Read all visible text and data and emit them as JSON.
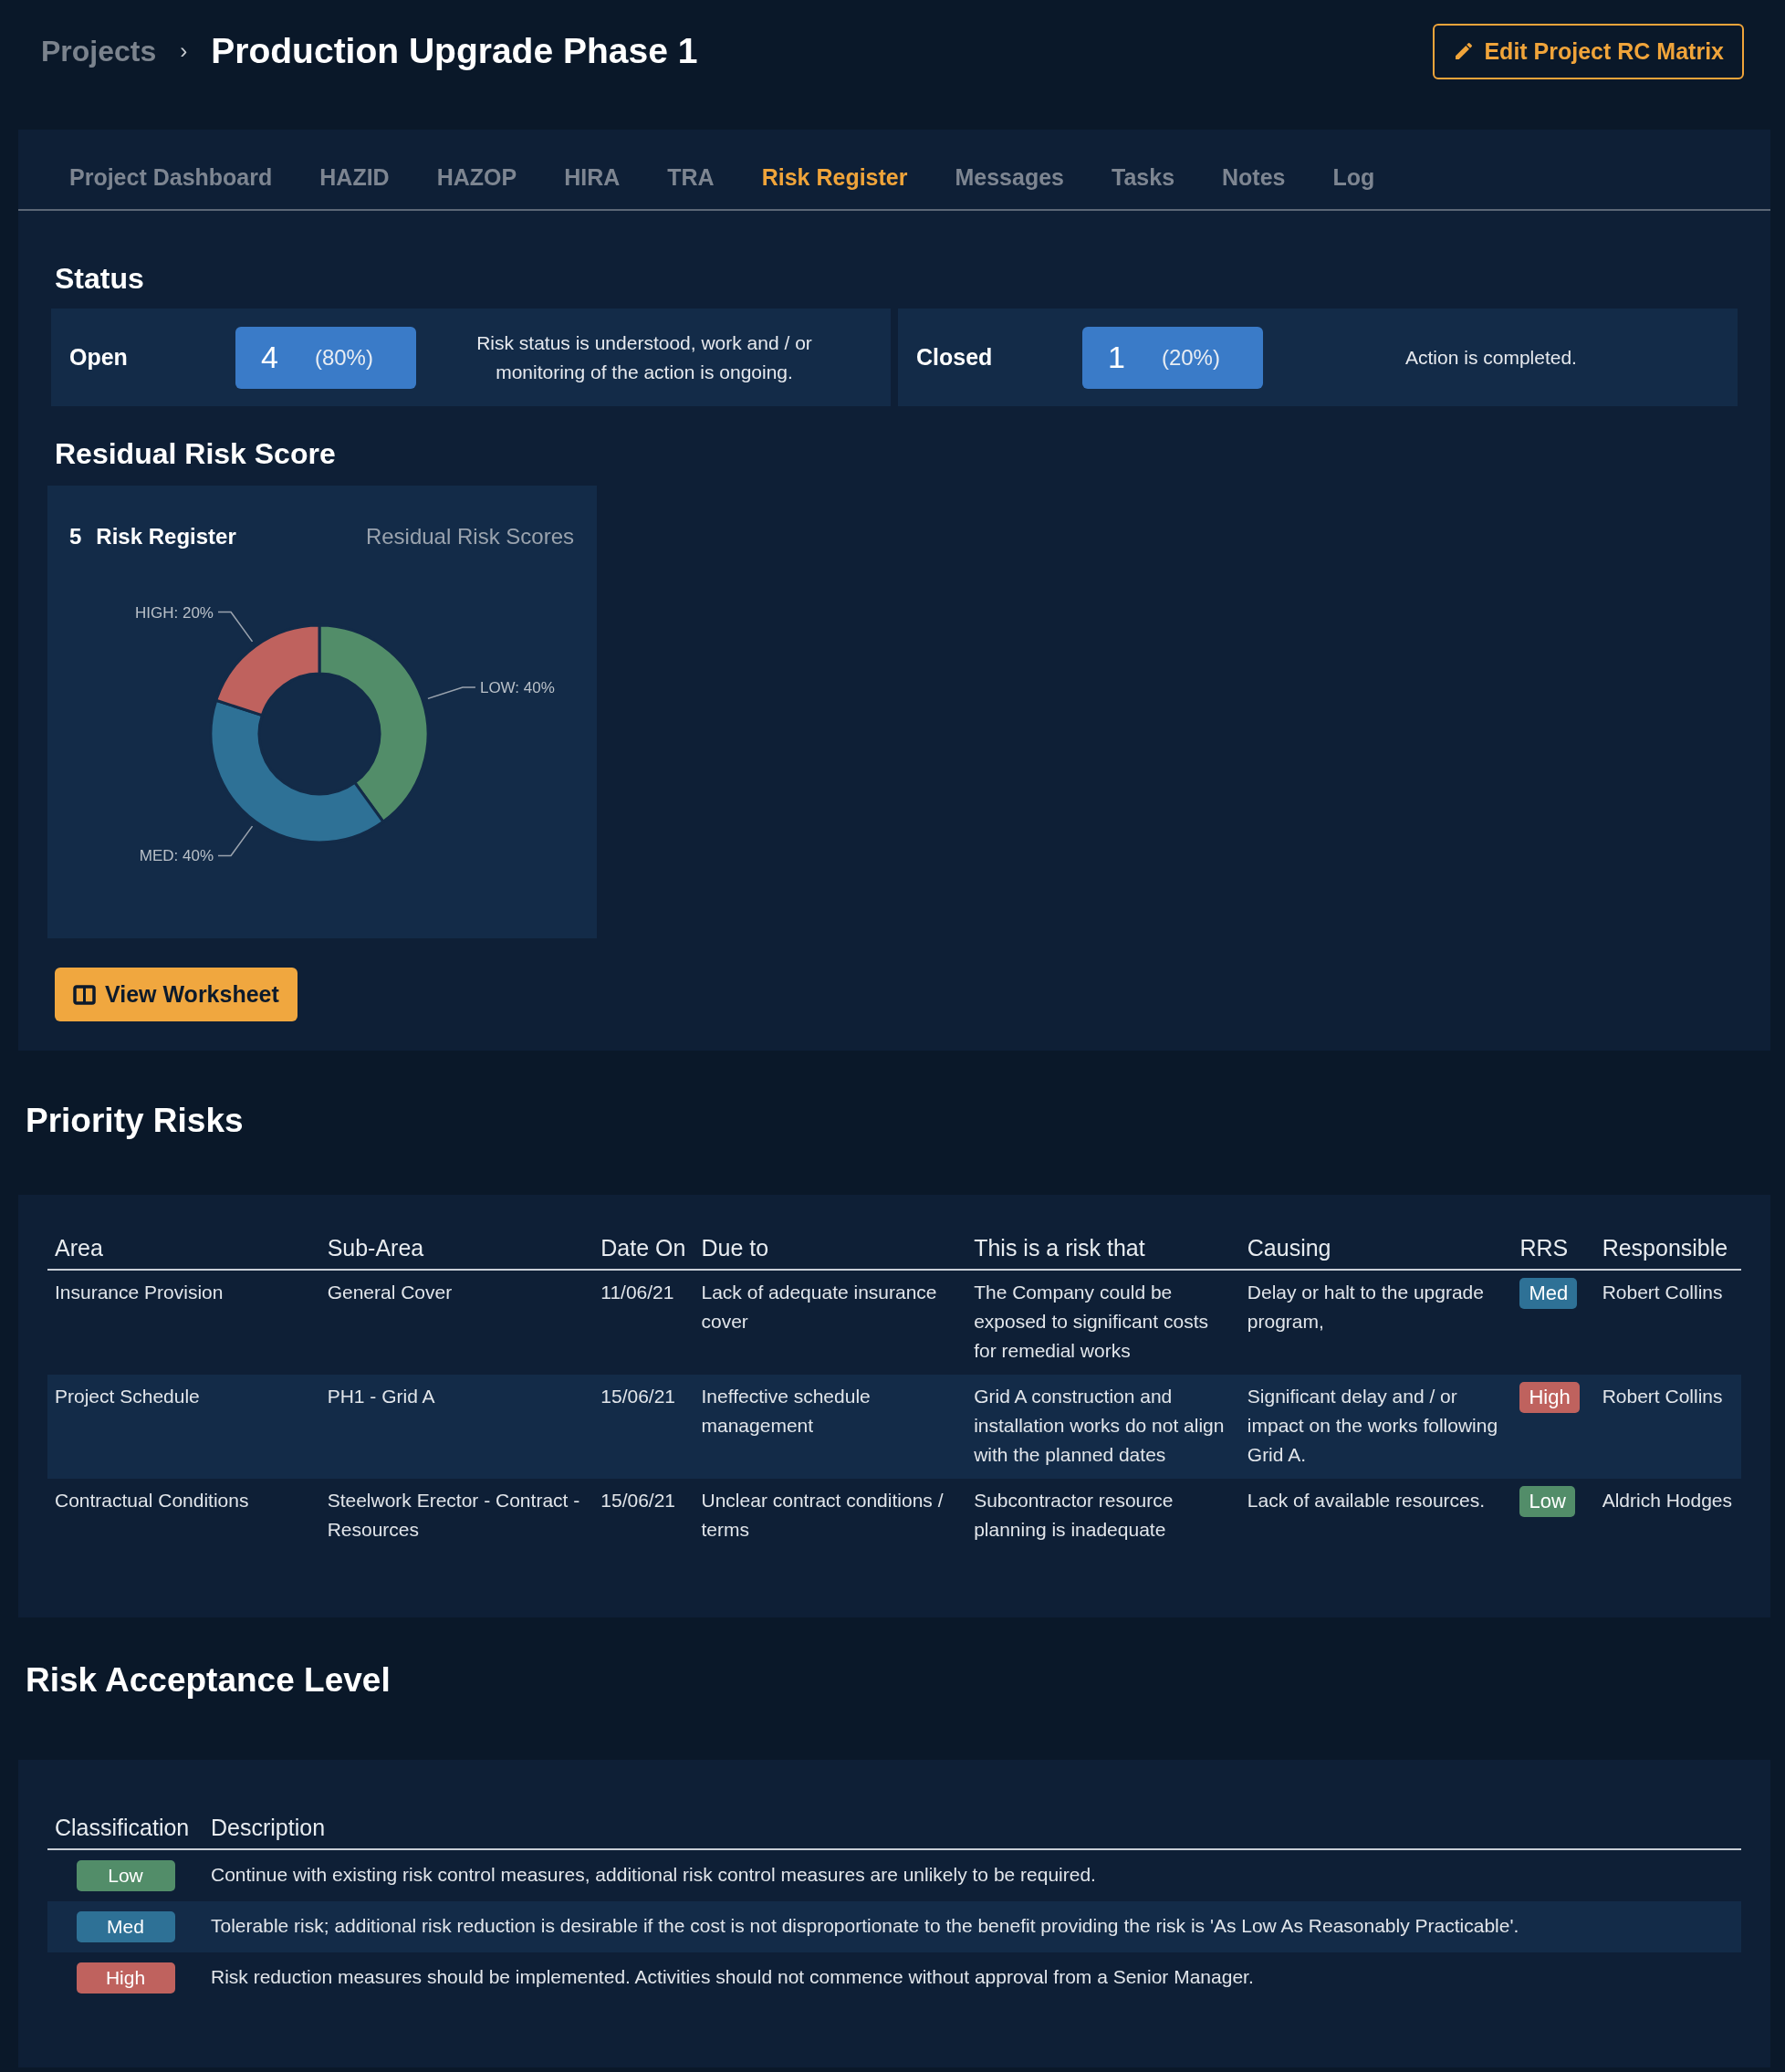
{
  "breadcrumb": {
    "parent": "Projects",
    "separator": "›",
    "title": "Production Upgrade Phase 1"
  },
  "edit_button": {
    "label": "Edit Project RC Matrix"
  },
  "tabs": [
    {
      "label": "Project Dashboard",
      "selected": false
    },
    {
      "label": "HAZID",
      "selected": false
    },
    {
      "label": "HAZOP",
      "selected": false
    },
    {
      "label": "HIRA",
      "selected": false
    },
    {
      "label": "TRA",
      "selected": false
    },
    {
      "label": "Risk Register",
      "selected": true
    },
    {
      "label": "Messages",
      "selected": false
    },
    {
      "label": "Tasks",
      "selected": false
    },
    {
      "label": "Notes",
      "selected": false
    },
    {
      "label": "Log",
      "selected": false
    }
  ],
  "status": {
    "heading": "Status",
    "cards": [
      {
        "label": "Open",
        "count": "4",
        "percent": "(80%)",
        "description": "Risk status is understood, work and / or monitoring of the action is ongoing."
      },
      {
        "label": "Closed",
        "count": "1",
        "percent": "(20%)",
        "description": "Action is completed."
      }
    ]
  },
  "residual": {
    "heading": "Residual Risk Score",
    "card": {
      "count": "5",
      "title": "Risk Register",
      "chart_data": {
        "type": "donut",
        "title": "Residual Risk Scores",
        "categories": [
          "LOW: 40%",
          "MED: 40%",
          "HIGH: 20%"
        ],
        "values": [
          40,
          40,
          20
        ]
      }
    },
    "button": "View Worksheet"
  },
  "priority": {
    "heading": "Priority Risks",
    "columns": [
      "Area",
      "Sub-Area",
      "Date On",
      "Due to",
      "This is a risk that",
      "Causing",
      "RRS",
      "Responsible"
    ],
    "rows": [
      {
        "cells": [
          "Insurance Provision",
          "General Cover",
          "11/06/21",
          "Lack of adequate insurance cover",
          "The Company could be exposed to significant costs for remedial works",
          "Delay or halt to the upgrade program,"
        ],
        "rrs": {
          "label": "Med",
          "color": "#2e7196"
        },
        "responsible": "Robert Collins"
      },
      {
        "cells": [
          "Project Schedule",
          "PH1 - Grid A",
          "15/06/21",
          "Ineffective schedule management",
          "Grid A construction and installation works do not align with the planned dates",
          "Significant delay and / or impact on the works following Grid A."
        ],
        "rrs": {
          "label": "High",
          "color": "#bf625e"
        },
        "responsible": "Robert Collins"
      },
      {
        "cells": [
          "Contractual Conditions",
          "Steelwork Erector - Contract - Resources",
          "15/06/21",
          "Unclear contract conditions / terms",
          "Subcontractor resource planning is inadequate",
          "Lack of available resources."
        ],
        "rrs": {
          "label": "Low",
          "color": "#528d69"
        },
        "responsible": "Aldrich Hodges"
      }
    ]
  },
  "acceptance": {
    "heading": "Risk Acceptance Level",
    "columns": [
      "Classification",
      "Description"
    ],
    "rows": [
      {
        "classification": {
          "label": "Low",
          "color": "#528d69"
        },
        "description": "Continue with existing risk control measures, additional risk control measures are unlikely to be required."
      },
      {
        "classification": {
          "label": "Med",
          "color": "#2e7196"
        },
        "description": "Tolerable risk; additional risk reduction is desirable if the cost is not disproportionate to the benefit providing the risk is 'As Low As Reasonably Practicable'."
      },
      {
        "classification": {
          "label": "High",
          "color": "#bf625e"
        },
        "description": "Risk reduction measures should be implemented. Activities should not commence without approval from a Senior Manager."
      }
    ]
  }
}
